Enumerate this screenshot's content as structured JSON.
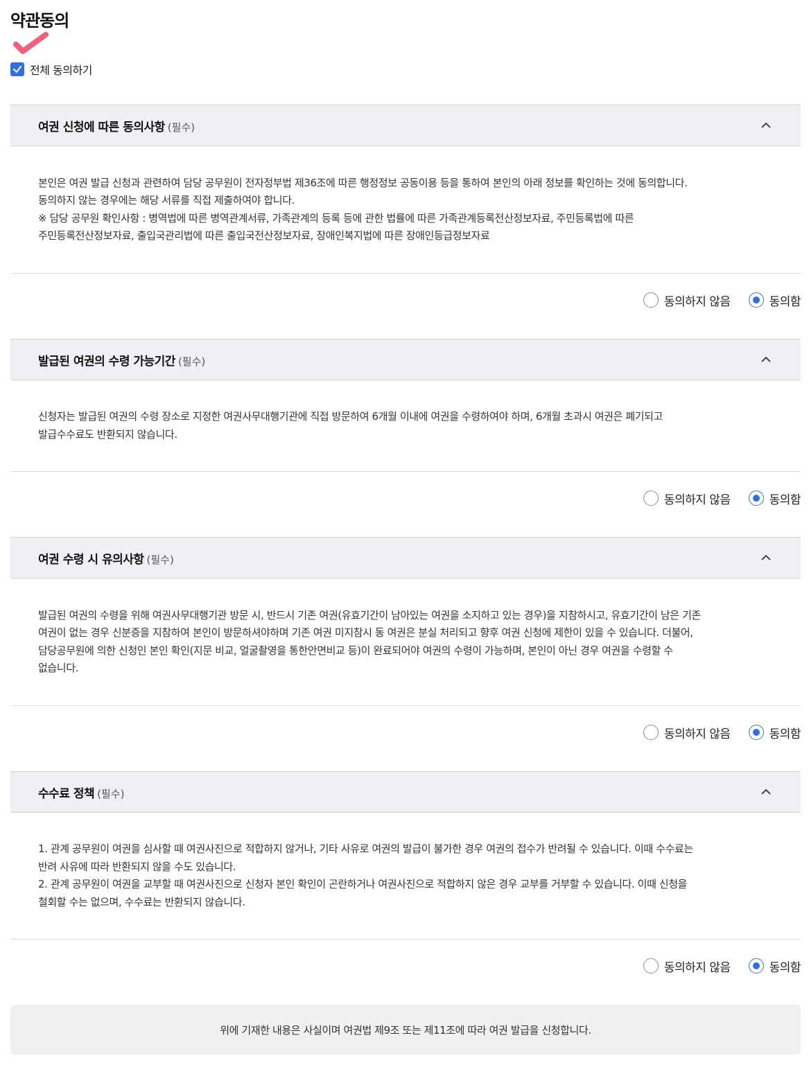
{
  "page": {
    "title": "약관동의",
    "agree_all_label": "전체 동의하기"
  },
  "sections": [
    {
      "title": "여권 신청에 따른 동의사항",
      "required": "(필수)",
      "body": [
        "본인은 여권 발급 신청과 관련하여 담당 공무원이 전자정부법 제36조에 따른 행정정보 공동이용 등을 통하여 본인의 아래 정보를 확인하는 것에 동의합니다.",
        "동의하지 않는 경우에는 해당 서류를 직접 제출하여야 합니다.",
        "※ 담당 공무원 확인사항 : 병역법에 따른 병역관계서류, 가족관계의 등록 등에 관한 법률에 따른 가족관계등록전산정보자료, 주민등록법에 따른",
        "주민등록전산정보자료, 출입국관리법에 따른 출입국전산정보자료, 장애인복지법에 따른 장애인등급정보자료"
      ],
      "disagree_label": "동의하지 않음",
      "agree_label": "동의함"
    },
    {
      "title": "발급된 여권의 수령 가능기간",
      "required": "(필수)",
      "body": [
        "신청자는 발급된 여권의 수령 장소로 지정한 여권사무대행기관에 직접 방문하여 6개월 이내에 여권을 수령하여야 하며, 6개월 초과시 여권은 폐기되고",
        "발급수수료도 반환되지 않습니다."
      ],
      "disagree_label": "동의하지 않음",
      "agree_label": "동의함"
    },
    {
      "title": "여권 수령 시 유의사항",
      "required": "(필수)",
      "body": [
        "발급된 여권의 수령을 위해 여권사무대행기관 방문 시, 반드시 기존 여권(유효기간이 남아있는 여권을 소지하고 있는 경우)을 지참하시고, 유효기간이 남은 기존",
        "여권이 없는 경우 신분증을 지참하여 본인이 방문하셔야하며 기존 여권 미지참시 동 여권은 분실 처리되고 향후 여권 신청에 제한이 있을 수 있습니다. 더불어,",
        "담당공무원에 의한 신청인 본인 확인(지문 비교, 얼굴촬영을 통한안면비교 등)이 완료되어야 여권의 수령이 가능하며, 본인이 아닌 경우 여권을 수령할 수",
        "없습니다."
      ],
      "disagree_label": "동의하지 않음",
      "agree_label": "동의함"
    },
    {
      "title": "수수료 정책",
      "required": "(필수)",
      "body": [
        "1. 관계 공무원이 여권을 심사할 때 여권사진으로 적합하지 않거나, 기타 사유로 여권의 발급이 불가한 경우 여권의 접수가 반려될 수 있습니다. 이때 수수료는",
        "반려 사유에 따라 반환되지 않을 수도 있습니다.",
        "2. 관계 공무원이 여권을 교부할 때 여권사진으로 신청자 본인 확인이 곤란하거나 여권사진으로 적합하지 않은 경우 교부를 거부할 수 있습니다. 이때 신청을",
        "철회할 수는 없으며, 수수료는 반환되지 않습니다."
      ],
      "disagree_label": "동의하지 않음",
      "agree_label": "동의함"
    }
  ],
  "footer": {
    "declaration": "위에 기재한 내용은 사실이며 여권법 제9조 또는 제11조에 따라 여권 발급을 신청합니다."
  },
  "colors": {
    "accent": "#2f6fe4",
    "checkmark_annotation": "#f0607a",
    "section_header_bg": "#eef0f3"
  }
}
